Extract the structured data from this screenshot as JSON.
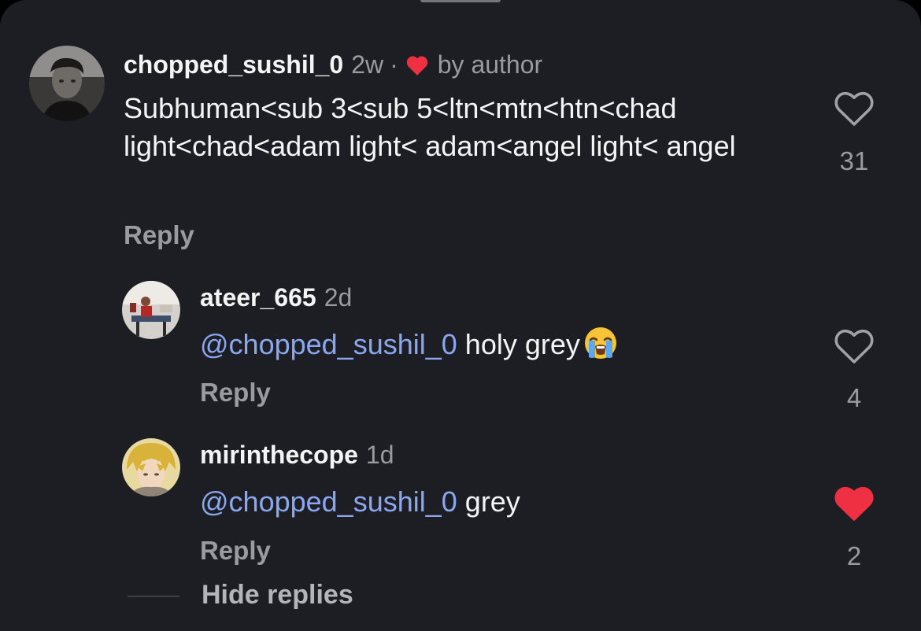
{
  "comments": [
    {
      "username": "chopped_sushil_0",
      "time": "2w",
      "dot": "·",
      "author_label": "by author",
      "text": "Subhuman<sub 3<sub 5<ltn<mtn<htn<chad light<chad<adam light< adam<angel light< angel",
      "reply_label": "Reply",
      "likes": "31",
      "liked": false,
      "avatar_icon": "user-photo-avatar"
    },
    {
      "username": "ateer_665",
      "time": "2d",
      "mention": "@chopped_sushil_0",
      "text": "holy grey",
      "emoji": "loudly-crying-face-emoji",
      "reply_label": "Reply",
      "likes": "4",
      "liked": false,
      "avatar_icon": "gym-photo-avatar"
    },
    {
      "username": "mirinthecope",
      "time": "1d",
      "mention": "@chopped_sushil_0",
      "text": "grey",
      "reply_label": "Reply",
      "likes": "2",
      "liked": true,
      "avatar_icon": "anime-character-avatar"
    }
  ],
  "hide_replies_label": "Hide replies",
  "colors": {
    "background": "#1d1e23",
    "mention": "#8ba7ef",
    "like_active": "#ef3042",
    "secondary_text": "#9a9ba1"
  }
}
